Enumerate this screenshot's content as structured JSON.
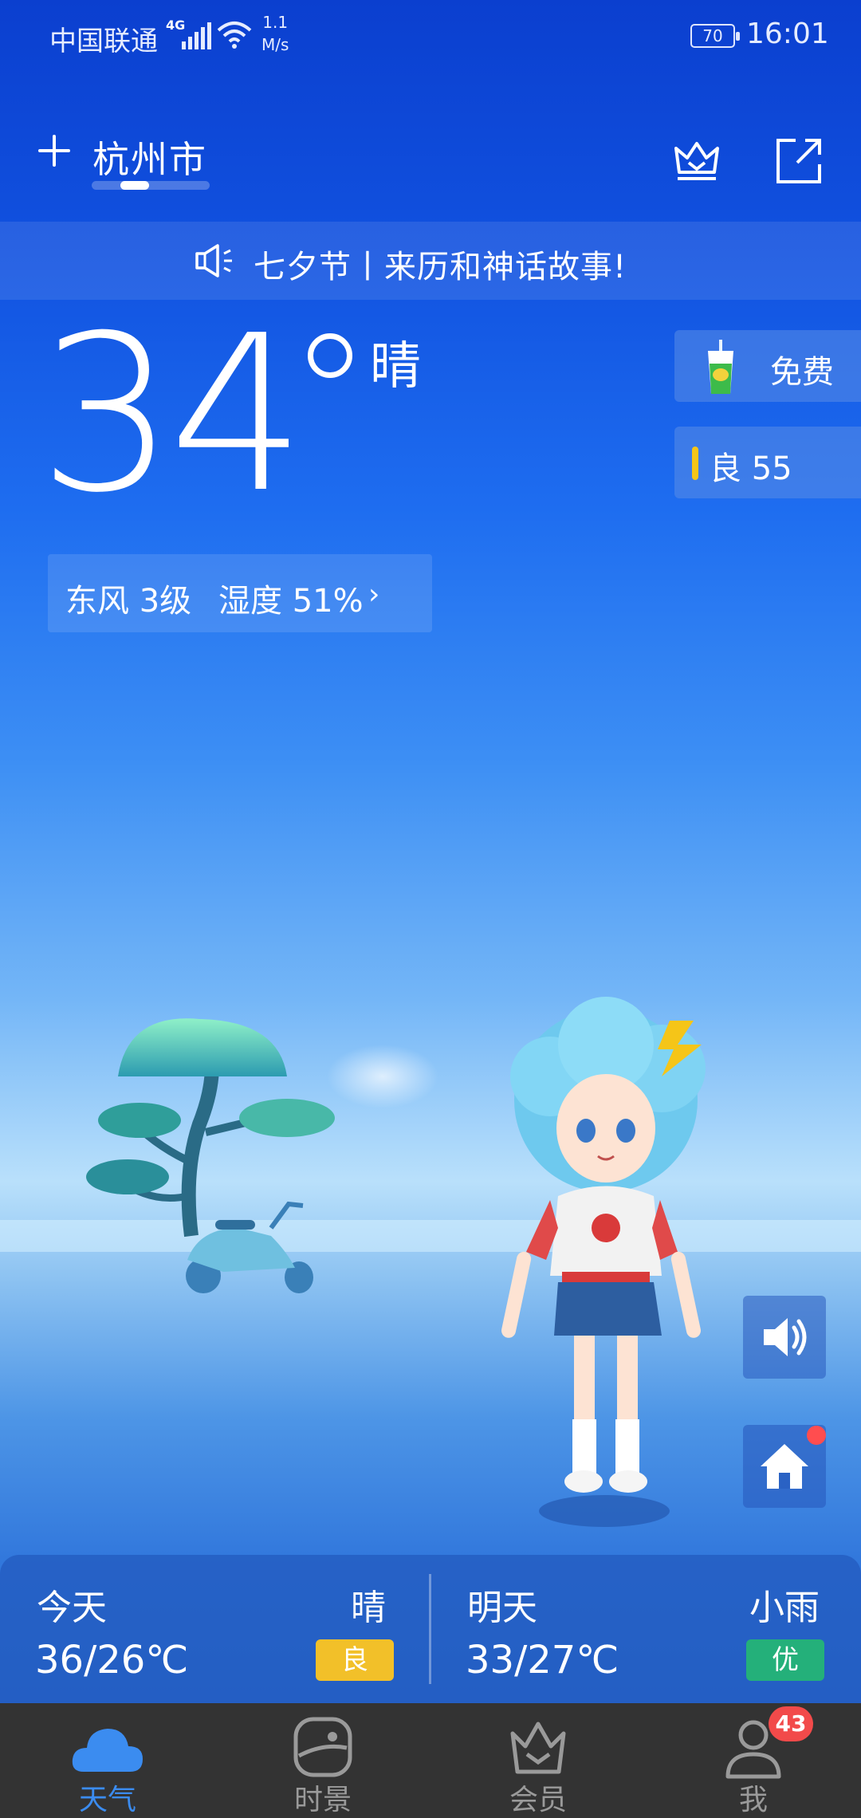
{
  "status_bar": {
    "carrier": "中国联通",
    "network": "4G",
    "speed_value": "1.1",
    "speed_unit": "M/s",
    "battery": "70",
    "time": "16:01"
  },
  "header": {
    "city": "杭州市",
    "icons": [
      "plus-icon",
      "crown-icon",
      "share-icon"
    ]
  },
  "notice": {
    "text": "七夕节丨来历和神话故事!",
    "icon": "speaker-icon"
  },
  "current": {
    "temperature": "34",
    "condition": "晴",
    "wind": "东风 3级",
    "humidity": "湿度 51%",
    "chevron": "›"
  },
  "side": {
    "free_label": "免费",
    "aqi_label": "良 55"
  },
  "forecast": {
    "today": {
      "day": "今天",
      "condition": "晴",
      "temp": "36/26℃",
      "air": "良",
      "air_color": "#f2c029"
    },
    "tomorrow": {
      "day": "明天",
      "condition": "小雨",
      "temp": "33/27℃",
      "air": "优",
      "air_color": "#24b07a"
    }
  },
  "nav": {
    "items": [
      {
        "label": "天气",
        "icon": "cloud-icon",
        "active": true
      },
      {
        "label": "时景",
        "icon": "scenery-icon",
        "active": false
      },
      {
        "label": "会员",
        "icon": "crown-icon",
        "active": false
      },
      {
        "label": "我",
        "icon": "person-icon",
        "active": false
      }
    ],
    "badge": "43"
  },
  "colors": {
    "accent": "#3b8cf0",
    "nav_bg": "#333333",
    "aqi_good": "#f5c518",
    "red_dot": "#ff4d4f"
  }
}
